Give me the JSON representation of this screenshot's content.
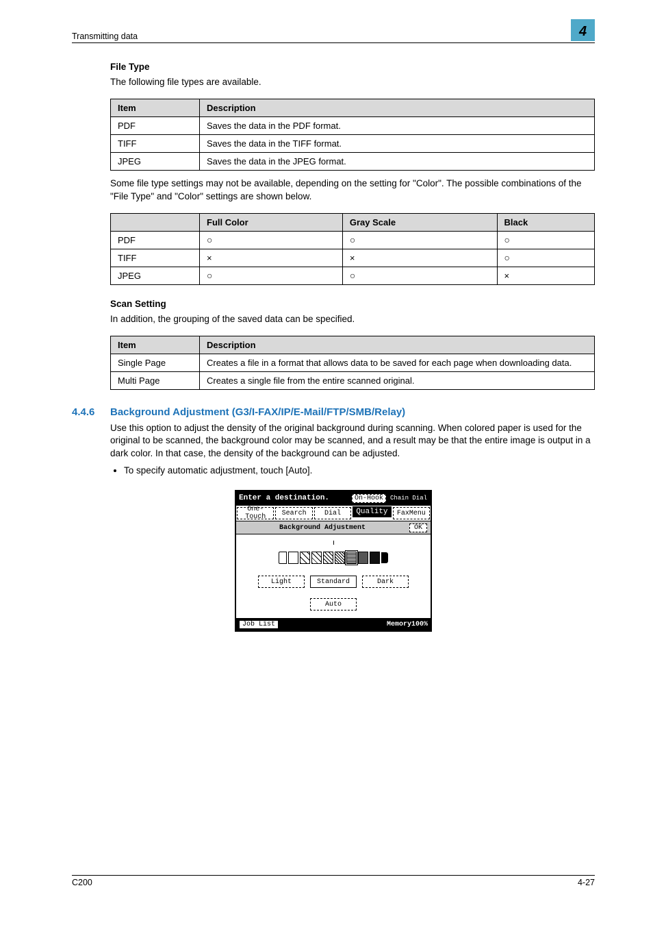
{
  "header": {
    "left": "Transmitting data",
    "right": "4"
  },
  "fileType": {
    "heading": "File Type",
    "intro": "The following file types are available.",
    "table": {
      "headers": [
        "Item",
        "Description"
      ],
      "rows": [
        [
          "PDF",
          "Saves the data in the PDF format."
        ],
        [
          "TIFF",
          "Saves the data in the TIFF format."
        ],
        [
          "JPEG",
          "Saves the data in the JPEG format."
        ]
      ]
    },
    "note": "Some file type settings may not be available, depending on the setting for \"Color\". The possible combinations of the \"File Type\" and \"Color\" settings are shown below."
  },
  "compat": {
    "headers": [
      "",
      "Full Color",
      "Gray Scale",
      "Black"
    ],
    "rows": [
      [
        "PDF",
        "○",
        "○",
        "○"
      ],
      [
        "TIFF",
        "×",
        "×",
        "○"
      ],
      [
        "JPEG",
        "○",
        "○",
        "×"
      ]
    ]
  },
  "scanSetting": {
    "heading": "Scan Setting",
    "intro": "In addition, the grouping of the saved data can be specified.",
    "table": {
      "headers": [
        "Item",
        "Description"
      ],
      "rows": [
        [
          "Single Page",
          "Creates a file in a format that allows data to be saved for each page when downloading data."
        ],
        [
          "Multi Page",
          "Creates a single file from the entire scanned original."
        ]
      ]
    }
  },
  "subsection": {
    "num": "4.4.6",
    "title": "Background Adjustment (G3/I-FAX/IP/E-Mail/FTP/SMB/Relay)",
    "body": "Use this option to adjust the density of the original background during scanning. When colored paper is used for the original to be scanned, the background color may be scanned, and a result may be that the entire image is output in a dark color. In that case, the density of the background can be adjusted.",
    "bullet": "To specify automatic adjustment, touch [Auto]."
  },
  "lcd": {
    "top_prompt": "Enter a destination.",
    "on_hook": "On-Hook",
    "chain_dial": "Chain Dial",
    "tabs": [
      "One-Touch",
      "Search",
      "Dial",
      "Quality",
      "FaxMenu"
    ],
    "title": "Background Adjustment",
    "ok": "OK",
    "light": "Light",
    "standard": "Standard",
    "dark": "Dark",
    "auto": "Auto",
    "job_list": "Job List",
    "memory": "Memory100%"
  },
  "footer": {
    "left": "C200",
    "right": "4-27"
  }
}
